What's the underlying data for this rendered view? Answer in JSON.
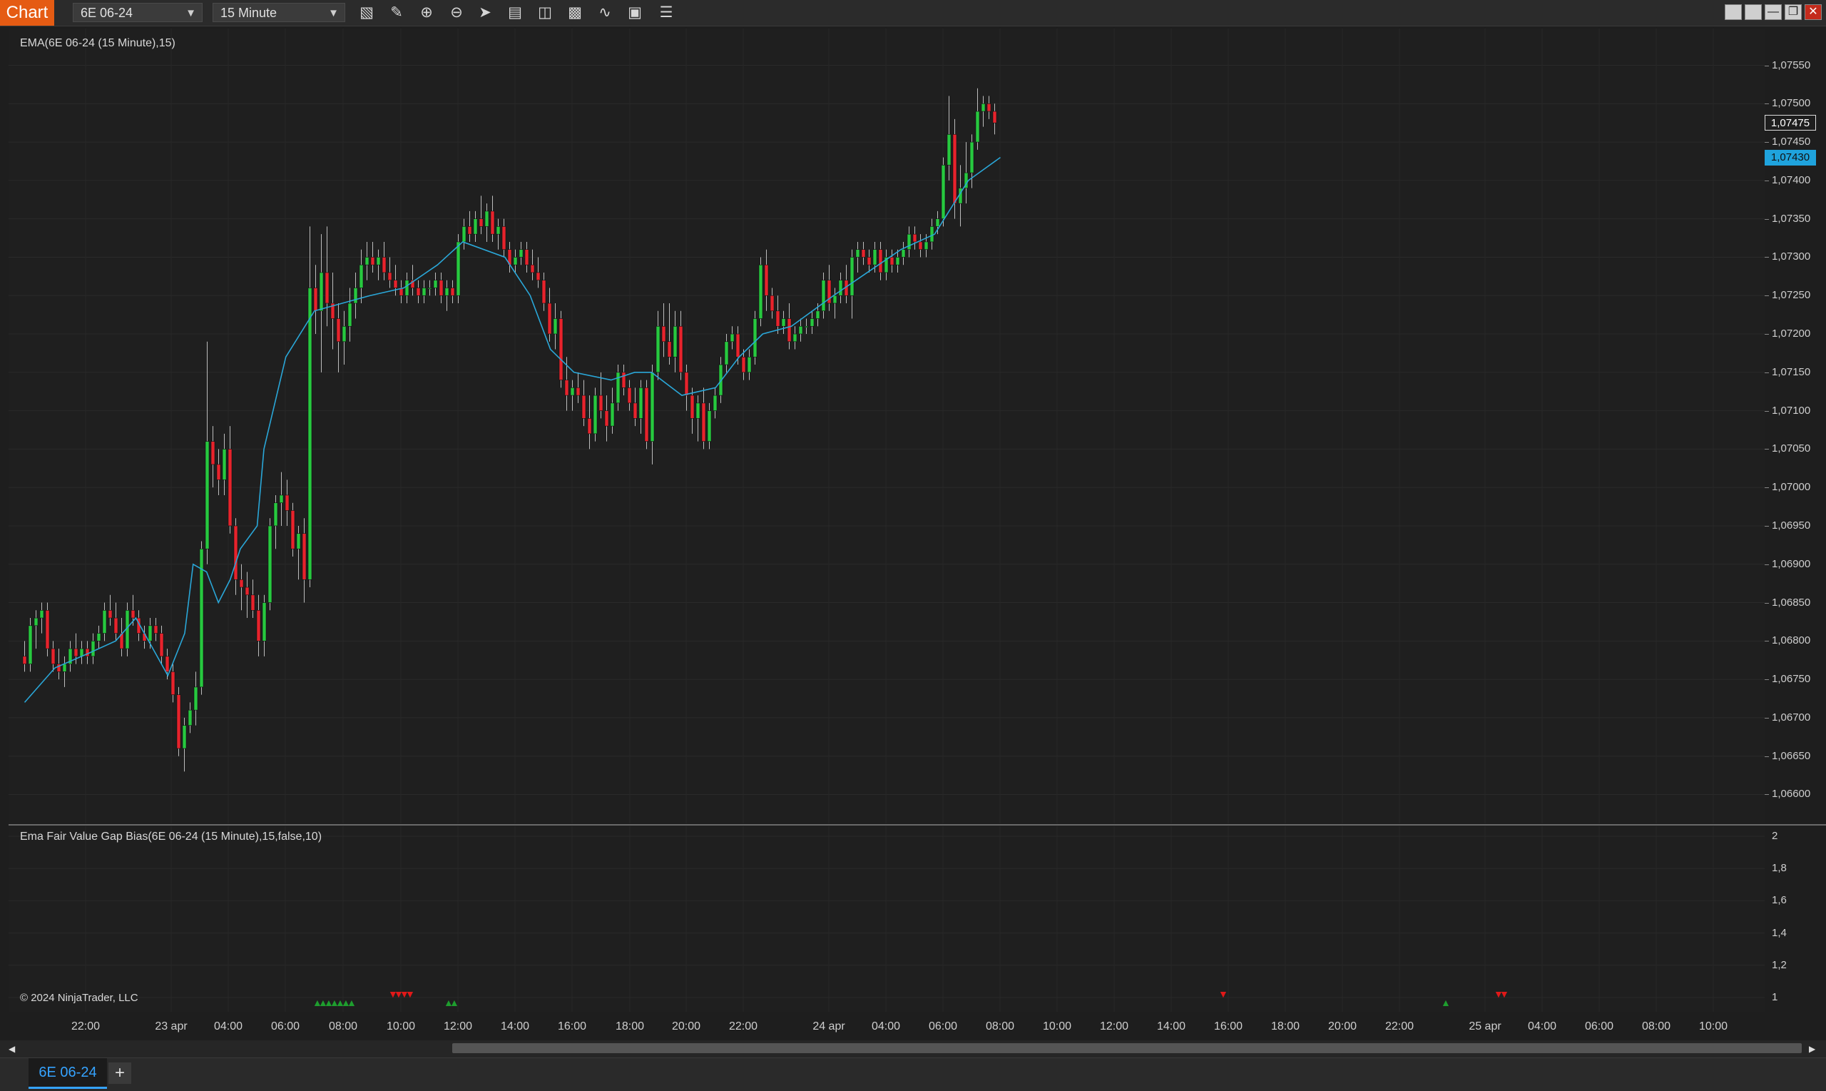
{
  "toolbar": {
    "chart_tab": "Chart",
    "instrument": "6E 06-24",
    "interval": "15 Minute",
    "icons": [
      "bar-type-icon",
      "drawing-tool-icon",
      "zoom-in-icon",
      "zoom-out-icon",
      "pointer-icon",
      "data-box-icon",
      "properties-icon",
      "window-linking-icon",
      "indicators-icon",
      "strategies-icon",
      "more-menu-icon"
    ]
  },
  "price_panel": {
    "label": "EMA(6E 06-24 (15 Minute),15)",
    "y_ticks": [
      "1,07550",
      "1,07500",
      "1,07450",
      "1,07400",
      "1,07350",
      "1,07300",
      "1,07250",
      "1,07200",
      "1,07150",
      "1,07100",
      "1,07050",
      "1,07000",
      "1,06950",
      "1,06900",
      "1,06850",
      "1,06800",
      "1,06750",
      "1,06700",
      "1,06650",
      "1,06600"
    ],
    "last_price": "1,07475",
    "ema_value": "1,07430",
    "colors": {
      "up": "#27c93f",
      "down": "#e8232c",
      "ema": "#2aa7d8",
      "ema_badge": "#1fa3dd"
    }
  },
  "indicator_panel": {
    "label": "Ema Fair Value Gap Bias(6E 06-24 (15 Minute),15,false,10)",
    "y_ticks": [
      "2",
      "1,8",
      "1,6",
      "1,4",
      "1,2",
      "1"
    ],
    "copyright": "© 2024 NinjaTrader, LLC"
  },
  "x_axis": {
    "labels": [
      "22:00",
      "23 apr",
      "04:00",
      "06:00",
      "08:00",
      "10:00",
      "12:00",
      "14:00",
      "16:00",
      "18:00",
      "20:00",
      "22:00",
      "24 apr",
      "04:00",
      "06:00",
      "08:00",
      "10:00",
      "12:00",
      "14:00",
      "16:00",
      "18:00",
      "20:00",
      "22:00",
      "25 apr",
      "04:00",
      "06:00",
      "08:00",
      "10:00"
    ]
  },
  "bottom_tabs": {
    "active": "6E 06-24",
    "add": "+"
  },
  "chart_data": {
    "type": "candlestick",
    "ylim": [
      1.0658,
      1.0757
    ],
    "ema_period": 15,
    "candles": [
      [
        1.0678,
        1.068,
        1.0676,
        1.0677
      ],
      [
        1.0677,
        1.0683,
        1.0676,
        1.0682
      ],
      [
        1.0682,
        1.0684,
        1.0679,
        1.0683
      ],
      [
        1.0683,
        1.0685,
        1.0681,
        1.0684
      ],
      [
        1.0684,
        1.0685,
        1.0678,
        1.0679
      ],
      [
        1.0679,
        1.068,
        1.0676,
        1.0677
      ],
      [
        1.0677,
        1.0679,
        1.0675,
        1.0676
      ],
      [
        1.0676,
        1.0678,
        1.0674,
        1.0677
      ],
      [
        1.0677,
        1.068,
        1.0676,
        1.0679
      ],
      [
        1.0679,
        1.0681,
        1.0677,
        1.0678
      ],
      [
        1.0678,
        1.068,
        1.0677,
        1.0679
      ],
      [
        1.0679,
        1.068,
        1.0677,
        1.0678
      ],
      [
        1.0678,
        1.0681,
        1.0677,
        1.068
      ],
      [
        1.068,
        1.0682,
        1.0679,
        1.0681
      ],
      [
        1.0681,
        1.0685,
        1.068,
        1.0684
      ],
      [
        1.0684,
        1.0686,
        1.0682,
        1.0683
      ],
      [
        1.0683,
        1.0685,
        1.068,
        1.0681
      ],
      [
        1.0681,
        1.0683,
        1.0678,
        1.0679
      ],
      [
        1.0679,
        1.0685,
        1.0678,
        1.0684
      ],
      [
        1.0684,
        1.0686,
        1.0682,
        1.0683
      ],
      [
        1.0683,
        1.0684,
        1.068,
        1.0681
      ],
      [
        1.0681,
        1.0682,
        1.0679,
        1.068
      ],
      [
        1.068,
        1.0683,
        1.0679,
        1.0682
      ],
      [
        1.0682,
        1.0683,
        1.068,
        1.0681
      ],
      [
        1.0681,
        1.0682,
        1.0677,
        1.0678
      ],
      [
        1.0678,
        1.0679,
        1.0675,
        1.0676
      ],
      [
        1.0676,
        1.0677,
        1.0672,
        1.0673
      ],
      [
        1.0673,
        1.0674,
        1.0665,
        1.0666
      ],
      [
        1.0666,
        1.067,
        1.0663,
        1.0669
      ],
      [
        1.0669,
        1.0672,
        1.0668,
        1.0671
      ],
      [
        1.0671,
        1.0676,
        1.0669,
        1.0674
      ],
      [
        1.0674,
        1.0693,
        1.0673,
        1.0692
      ],
      [
        1.0692,
        1.0719,
        1.069,
        1.0706
      ],
      [
        1.0706,
        1.0708,
        1.07,
        1.0703
      ],
      [
        1.0703,
        1.0705,
        1.0699,
        1.0701
      ],
      [
        1.0701,
        1.0707,
        1.0699,
        1.0705
      ],
      [
        1.0705,
        1.0708,
        1.0694,
        1.0695
      ],
      [
        1.0695,
        1.0696,
        1.0686,
        1.0688
      ],
      [
        1.0688,
        1.069,
        1.0684,
        1.0687
      ],
      [
        1.0687,
        1.0689,
        1.0683,
        1.0686
      ],
      [
        1.0686,
        1.0688,
        1.0683,
        1.0684
      ],
      [
        1.0684,
        1.0686,
        1.0678,
        1.068
      ],
      [
        1.068,
        1.0686,
        1.0678,
        1.0685
      ],
      [
        1.0685,
        1.0696,
        1.0684,
        1.0695
      ],
      [
        1.0695,
        1.0699,
        1.0692,
        1.0698
      ],
      [
        1.0698,
        1.0702,
        1.0695,
        1.0699
      ],
      [
        1.0699,
        1.0701,
        1.0695,
        1.0697
      ],
      [
        1.0697,
        1.0698,
        1.0691,
        1.0692
      ],
      [
        1.0692,
        1.0695,
        1.0688,
        1.0694
      ],
      [
        1.0694,
        1.0696,
        1.0685,
        1.0688
      ],
      [
        1.0688,
        1.0734,
        1.0687,
        1.0726
      ],
      [
        1.0726,
        1.0729,
        1.072,
        1.0723
      ],
      [
        1.0723,
        1.0733,
        1.0715,
        1.0728
      ],
      [
        1.0728,
        1.0734,
        1.0721,
        1.0724
      ],
      [
        1.0724,
        1.0728,
        1.0718,
        1.0722
      ],
      [
        1.0722,
        1.0724,
        1.0715,
        1.0719
      ],
      [
        1.0719,
        1.0723,
        1.0716,
        1.0721
      ],
      [
        1.0721,
        1.0726,
        1.0719,
        1.0724
      ],
      [
        1.0724,
        1.0728,
        1.0722,
        1.0726
      ],
      [
        1.0726,
        1.0731,
        1.0724,
        1.0729
      ],
      [
        1.0729,
        1.0732,
        1.0727,
        1.073
      ],
      [
        1.073,
        1.0732,
        1.0728,
        1.0729
      ],
      [
        1.0729,
        1.0731,
        1.0727,
        1.073
      ],
      [
        1.073,
        1.0732,
        1.0727,
        1.0728
      ],
      [
        1.0728,
        1.073,
        1.0726,
        1.0727
      ],
      [
        1.0727,
        1.0729,
        1.0725,
        1.0726
      ],
      [
        1.0726,
        1.0727,
        1.0724,
        1.0725
      ],
      [
        1.0725,
        1.0728,
        1.0724,
        1.0727
      ],
      [
        1.0727,
        1.0729,
        1.0725,
        1.0726
      ],
      [
        1.0726,
        1.0727,
        1.0724,
        1.0725
      ],
      [
        1.0725,
        1.0727,
        1.0724,
        1.0726
      ],
      [
        1.0726,
        1.0727,
        1.0725,
        1.0726
      ],
      [
        1.0726,
        1.0728,
        1.0725,
        1.0727
      ],
      [
        1.0727,
        1.0728,
        1.0724,
        1.0725
      ],
      [
        1.0725,
        1.0727,
        1.0723,
        1.0726
      ],
      [
        1.0726,
        1.0727,
        1.0724,
        1.0725
      ],
      [
        1.0725,
        1.0733,
        1.0724,
        1.0732
      ],
      [
        1.0732,
        1.0735,
        1.0731,
        1.0734
      ],
      [
        1.0734,
        1.0736,
        1.0732,
        1.0733
      ],
      [
        1.0733,
        1.0736,
        1.0732,
        1.0735
      ],
      [
        1.0735,
        1.0738,
        1.0733,
        1.0734
      ],
      [
        1.0734,
        1.0737,
        1.0732,
        1.0736
      ],
      [
        1.0736,
        1.0738,
        1.0732,
        1.0733
      ],
      [
        1.0733,
        1.0735,
        1.0731,
        1.0734
      ],
      [
        1.0734,
        1.0735,
        1.073,
        1.0731
      ],
      [
        1.0731,
        1.0732,
        1.0728,
        1.0729
      ],
      [
        1.0729,
        1.0731,
        1.0728,
        1.073
      ],
      [
        1.073,
        1.0732,
        1.0729,
        1.0731
      ],
      [
        1.0731,
        1.0732,
        1.0728,
        1.0729
      ],
      [
        1.0729,
        1.0731,
        1.0727,
        1.0728
      ],
      [
        1.0728,
        1.073,
        1.0726,
        1.0727
      ],
      [
        1.0727,
        1.0728,
        1.0723,
        1.0724
      ],
      [
        1.0724,
        1.0726,
        1.0719,
        1.072
      ],
      [
        1.072,
        1.0724,
        1.0718,
        1.0722
      ],
      [
        1.0722,
        1.0723,
        1.0713,
        1.0714
      ],
      [
        1.0714,
        1.0717,
        1.071,
        1.0712
      ],
      [
        1.0712,
        1.0714,
        1.071,
        1.0713
      ],
      [
        1.0713,
        1.0715,
        1.0711,
        1.0712
      ],
      [
        1.0712,
        1.0714,
        1.0708,
        1.0709
      ],
      [
        1.0709,
        1.0712,
        1.0705,
        1.0707
      ],
      [
        1.0707,
        1.0713,
        1.0706,
        1.0712
      ],
      [
        1.0712,
        1.0715,
        1.0709,
        1.071
      ],
      [
        1.071,
        1.0712,
        1.0706,
        1.0708
      ],
      [
        1.0708,
        1.0713,
        1.0707,
        1.0711
      ],
      [
        1.0711,
        1.0716,
        1.071,
        1.0715
      ],
      [
        1.0715,
        1.0716,
        1.0712,
        1.0713
      ],
      [
        1.0713,
        1.0714,
        1.071,
        1.0711
      ],
      [
        1.0711,
        1.0713,
        1.0708,
        1.0709
      ],
      [
        1.0709,
        1.0714,
        1.0707,
        1.0713
      ],
      [
        1.0713,
        1.0714,
        1.0705,
        1.0706
      ],
      [
        1.0706,
        1.0716,
        1.0703,
        1.0715
      ],
      [
        1.0715,
        1.0723,
        1.0714,
        1.0721
      ],
      [
        1.0721,
        1.0724,
        1.0717,
        1.0719
      ],
      [
        1.0719,
        1.0724,
        1.0716,
        1.0717
      ],
      [
        1.0717,
        1.0723,
        1.0715,
        1.0721
      ],
      [
        1.0721,
        1.0723,
        1.0714,
        1.0715
      ],
      [
        1.0715,
        1.0716,
        1.071,
        1.0712
      ],
      [
        1.0712,
        1.0713,
        1.0707,
        1.0709
      ],
      [
        1.0709,
        1.0712,
        1.0706,
        1.0711
      ],
      [
        1.0711,
        1.0713,
        1.0705,
        1.0706
      ],
      [
        1.0706,
        1.0711,
        1.0705,
        1.071
      ],
      [
        1.071,
        1.0713,
        1.0709,
        1.0712
      ],
      [
        1.0712,
        1.0717,
        1.0711,
        1.0716
      ],
      [
        1.0716,
        1.072,
        1.0715,
        1.0719
      ],
      [
        1.0719,
        1.0721,
        1.0718,
        1.072
      ],
      [
        1.072,
        1.0721,
        1.0716,
        1.0717
      ],
      [
        1.0717,
        1.0718,
        1.0714,
        1.0715
      ],
      [
        1.0715,
        1.0718,
        1.0714,
        1.0717
      ],
      [
        1.0717,
        1.0723,
        1.0716,
        1.0722
      ],
      [
        1.0722,
        1.073,
        1.0721,
        1.0729
      ],
      [
        1.0729,
        1.0731,
        1.0723,
        1.0725
      ],
      [
        1.0725,
        1.0726,
        1.0722,
        1.0723
      ],
      [
        1.0723,
        1.0725,
        1.072,
        1.0721
      ],
      [
        1.0721,
        1.0723,
        1.072,
        1.0722
      ],
      [
        1.0722,
        1.0724,
        1.0718,
        1.0719
      ],
      [
        1.0719,
        1.0721,
        1.0718,
        1.072
      ],
      [
        1.072,
        1.0722,
        1.0719,
        1.0721
      ],
      [
        1.0721,
        1.0722,
        1.072,
        1.0721
      ],
      [
        1.0721,
        1.0723,
        1.072,
        1.0722
      ],
      [
        1.0722,
        1.0724,
        1.0721,
        1.0723
      ],
      [
        1.0723,
        1.0728,
        1.0722,
        1.0727
      ],
      [
        1.0727,
        1.0729,
        1.0723,
        1.0724
      ],
      [
        1.0724,
        1.0726,
        1.0722,
        1.0725
      ],
      [
        1.0725,
        1.0728,
        1.0724,
        1.0727
      ],
      [
        1.0727,
        1.0729,
        1.0724,
        1.0725
      ],
      [
        1.0725,
        1.0731,
        1.0722,
        1.073
      ],
      [
        1.073,
        1.0732,
        1.0728,
        1.0731
      ],
      [
        1.0731,
        1.0732,
        1.0729,
        1.073
      ],
      [
        1.073,
        1.0731,
        1.0728,
        1.0729
      ],
      [
        1.0729,
        1.0732,
        1.0728,
        1.0731
      ],
      [
        1.0731,
        1.0732,
        1.0727,
        1.0728
      ],
      [
        1.0728,
        1.0731,
        1.0727,
        1.073
      ],
      [
        1.073,
        1.0731,
        1.0728,
        1.0729
      ],
      [
        1.0729,
        1.0731,
        1.0728,
        1.073
      ],
      [
        1.073,
        1.0732,
        1.0729,
        1.0731
      ],
      [
        1.0731,
        1.0734,
        1.073,
        1.0733
      ],
      [
        1.0733,
        1.0734,
        1.0731,
        1.0732
      ],
      [
        1.0732,
        1.0733,
        1.073,
        1.0731
      ],
      [
        1.0731,
        1.0733,
        1.073,
        1.0732
      ],
      [
        1.0732,
        1.0735,
        1.0731,
        1.0734
      ],
      [
        1.0734,
        1.0736,
        1.0733,
        1.0735
      ],
      [
        1.0735,
        1.0743,
        1.0734,
        1.0742
      ],
      [
        1.0742,
        1.0751,
        1.074,
        1.0746
      ],
      [
        1.0746,
        1.0748,
        1.0735,
        1.0737
      ],
      [
        1.0737,
        1.0742,
        1.0734,
        1.0739
      ],
      [
        1.0739,
        1.0745,
        1.0737,
        1.0741
      ],
      [
        1.0741,
        1.0746,
        1.0739,
        1.0745
      ],
      [
        1.0745,
        1.0752,
        1.0744,
        1.0749
      ],
      [
        1.0749,
        1.0751,
        1.0747,
        1.075
      ],
      [
        1.075,
        1.0751,
        1.0748,
        1.0749
      ],
      [
        1.0749,
        1.075,
        1.0746,
        1.07475
      ]
    ],
    "ema_line": [
      [
        1.0672,
        0
      ],
      [
        1.06765,
        18
      ],
      [
        1.06785,
        39
      ],
      [
        1.068,
        54
      ],
      [
        1.0683,
        66
      ],
      [
        1.06755,
        85
      ],
      [
        1.0681,
        95
      ],
      [
        1.069,
        100
      ],
      [
        1.0689,
        108
      ],
      [
        1.0685,
        115
      ],
      [
        1.0688,
        122
      ],
      [
        1.0692,
        128
      ],
      [
        1.0695,
        138
      ],
      [
        1.0705,
        142
      ],
      [
        1.0717,
        155
      ],
      [
        1.0723,
        172
      ],
      [
        1.0725,
        205
      ],
      [
        1.0726,
        225
      ],
      [
        1.0729,
        245
      ],
      [
        1.0732,
        260
      ],
      [
        1.073,
        285
      ],
      [
        1.0725,
        300
      ],
      [
        1.0718,
        312
      ],
      [
        1.0715,
        326
      ],
      [
        1.0714,
        348
      ],
      [
        1.0715,
        362
      ],
      [
        1.0715,
        372
      ],
      [
        1.0712,
        390
      ],
      [
        1.0713,
        410
      ],
      [
        1.0717,
        424
      ],
      [
        1.072,
        438
      ],
      [
        1.0721,
        455
      ],
      [
        1.0725,
        480
      ],
      [
        1.0728,
        500
      ],
      [
        1.0731,
        520
      ],
      [
        1.0733,
        540
      ],
      [
        1.074,
        560
      ],
      [
        1.0743,
        579
      ]
    ],
    "fvg_bias_markers": [
      {
        "direction": "up",
        "count": 7,
        "position": "08:00"
      },
      {
        "direction": "down",
        "count": 4,
        "position": "10:00"
      },
      {
        "direction": "up",
        "count": 2,
        "position": "12:00"
      },
      {
        "direction": "down",
        "count": 1,
        "position": "16:00"
      },
      {
        "direction": "up",
        "count": 1,
        "position": "23:30"
      },
      {
        "direction": "down",
        "count": 2,
        "position": "25 apr"
      }
    ]
  }
}
